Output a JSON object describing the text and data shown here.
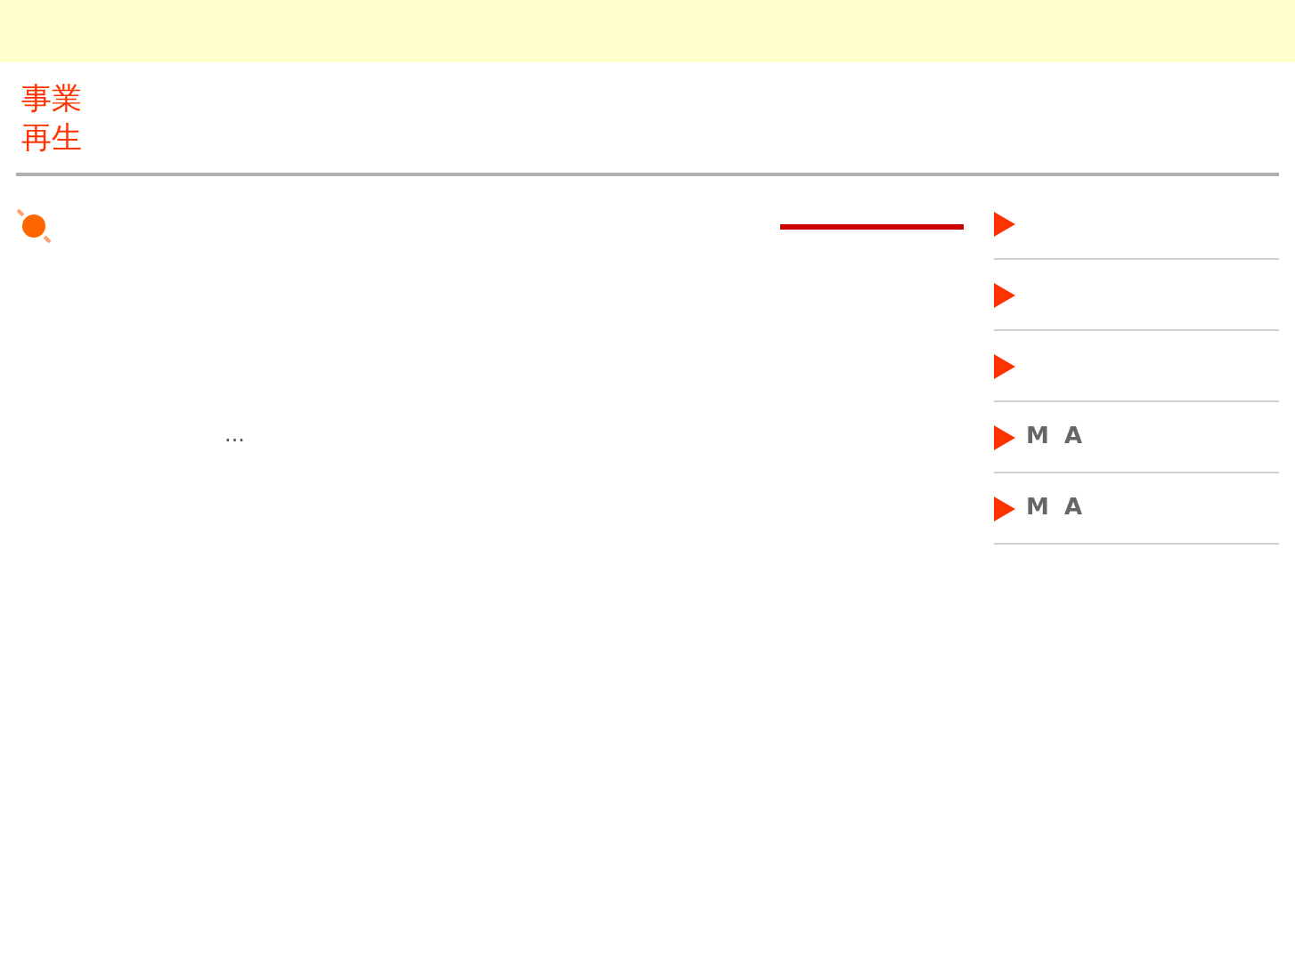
{
  "header": {
    "title_lines": [
      "事業",
      "再生"
    ]
  },
  "main": {
    "text": "..."
  },
  "sidebar": {
    "items": [
      {
        "kind": "arrow"
      },
      {
        "kind": "arrow"
      },
      {
        "kind": "arrow"
      },
      {
        "kind": "arrow",
        "label": "M A"
      },
      {
        "kind": "arrow",
        "label": "M A"
      }
    ]
  }
}
